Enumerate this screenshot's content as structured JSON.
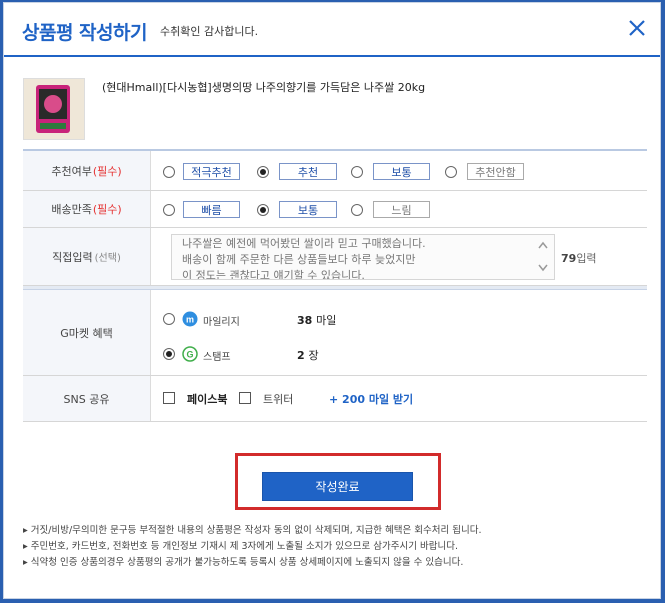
{
  "header": {
    "title": "상품평 작성하기",
    "subtitle": "수취확인 감사합니다."
  },
  "product": {
    "name": "(현대Hmall)[다시농협]생명의땅 나주의향기를 가득담은 나주쌀 20kg"
  },
  "recommend": {
    "label": "추천여부",
    "required": "(필수)",
    "options": [
      "적극추천",
      "추천",
      "보통",
      "추천안함"
    ],
    "selected": "추천"
  },
  "delivery": {
    "label": "배송만족",
    "required": "(필수)",
    "options": [
      "빠름",
      "보통",
      "느림"
    ],
    "selected": "보통"
  },
  "direct_input": {
    "label": "직접입력",
    "optional": "(선택)",
    "lines": [
      "나주쌀은 예전에 먹어봤던 쌀이라 믿고 구매했습니다.",
      "배송이 함께 주문한 다른 상품들보다 하루 늦었지만",
      "이 정도는 괜찮다고 얘기할 수 있습니다."
    ],
    "count": "79",
    "count_unit": "입력"
  },
  "benefit": {
    "label": "G마켓 혜택",
    "mileage_label": "마일리지",
    "mileage_value": "38",
    "mileage_unit": "마일",
    "stamp_label": "스탬프",
    "stamp_value": "2",
    "stamp_unit": "장",
    "selected": "스탬프"
  },
  "sns": {
    "label": "SNS 공유",
    "facebook": "페이스북",
    "twitter": "트위터",
    "bonus": "+ 200 마일 받기"
  },
  "submit_label": "작성완료",
  "notes": [
    "거짓/비방/무의미한 문구등 부적절한 내용의 상품평은 작성자 동의 없이 삭제되며, 지급한 혜택은 회수처리 됩니다.",
    "주민번호, 카드번호, 전화번호 등 개인정보 기재시 제 3자에게 노출될 소지가 있으므로 삼가주시기 바랍니다.",
    "식약청 인증 상품의경우 상품평의 공개가 불가능하도록 등록시 상품 상세페이지에 노출되지 않을 수 있습니다."
  ],
  "colors": {
    "accent": "#1f63c6",
    "required": "#e53232",
    "highlight_border": "#d22b2b"
  }
}
